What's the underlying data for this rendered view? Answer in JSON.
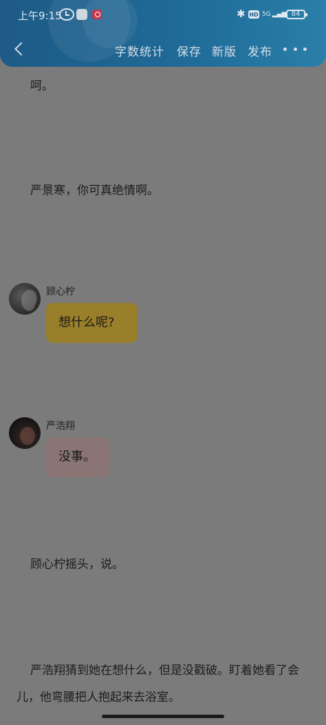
{
  "status_bar": {
    "time": "上午9:15",
    "network": "5G",
    "battery": "84",
    "hd_label": "HD"
  },
  "toolbar": {
    "word_count": "字数统计",
    "save": "保存",
    "new_version": "新版",
    "publish": "发布"
  },
  "content": {
    "line1": "呵。",
    "line2": "严景寒，你可真绝情啊。",
    "chat1": {
      "name": "顾心柠",
      "message": "想什么呢?"
    },
    "chat2": {
      "name": "严浩翔",
      "message": "没事。"
    },
    "line3": "顾心柠摇头，说。",
    "line4": "严浩翔猜到她在想什么，但是没戳破。盯着她看了会儿，他弯腰把人抱起来去浴室。"
  },
  "colors": {
    "toolbar_bg": "#1f6a97",
    "page_overlay": "#7b7b7b",
    "bubble_yellow": "#9a7f2a",
    "bubble_pink": "#8a7474"
  }
}
